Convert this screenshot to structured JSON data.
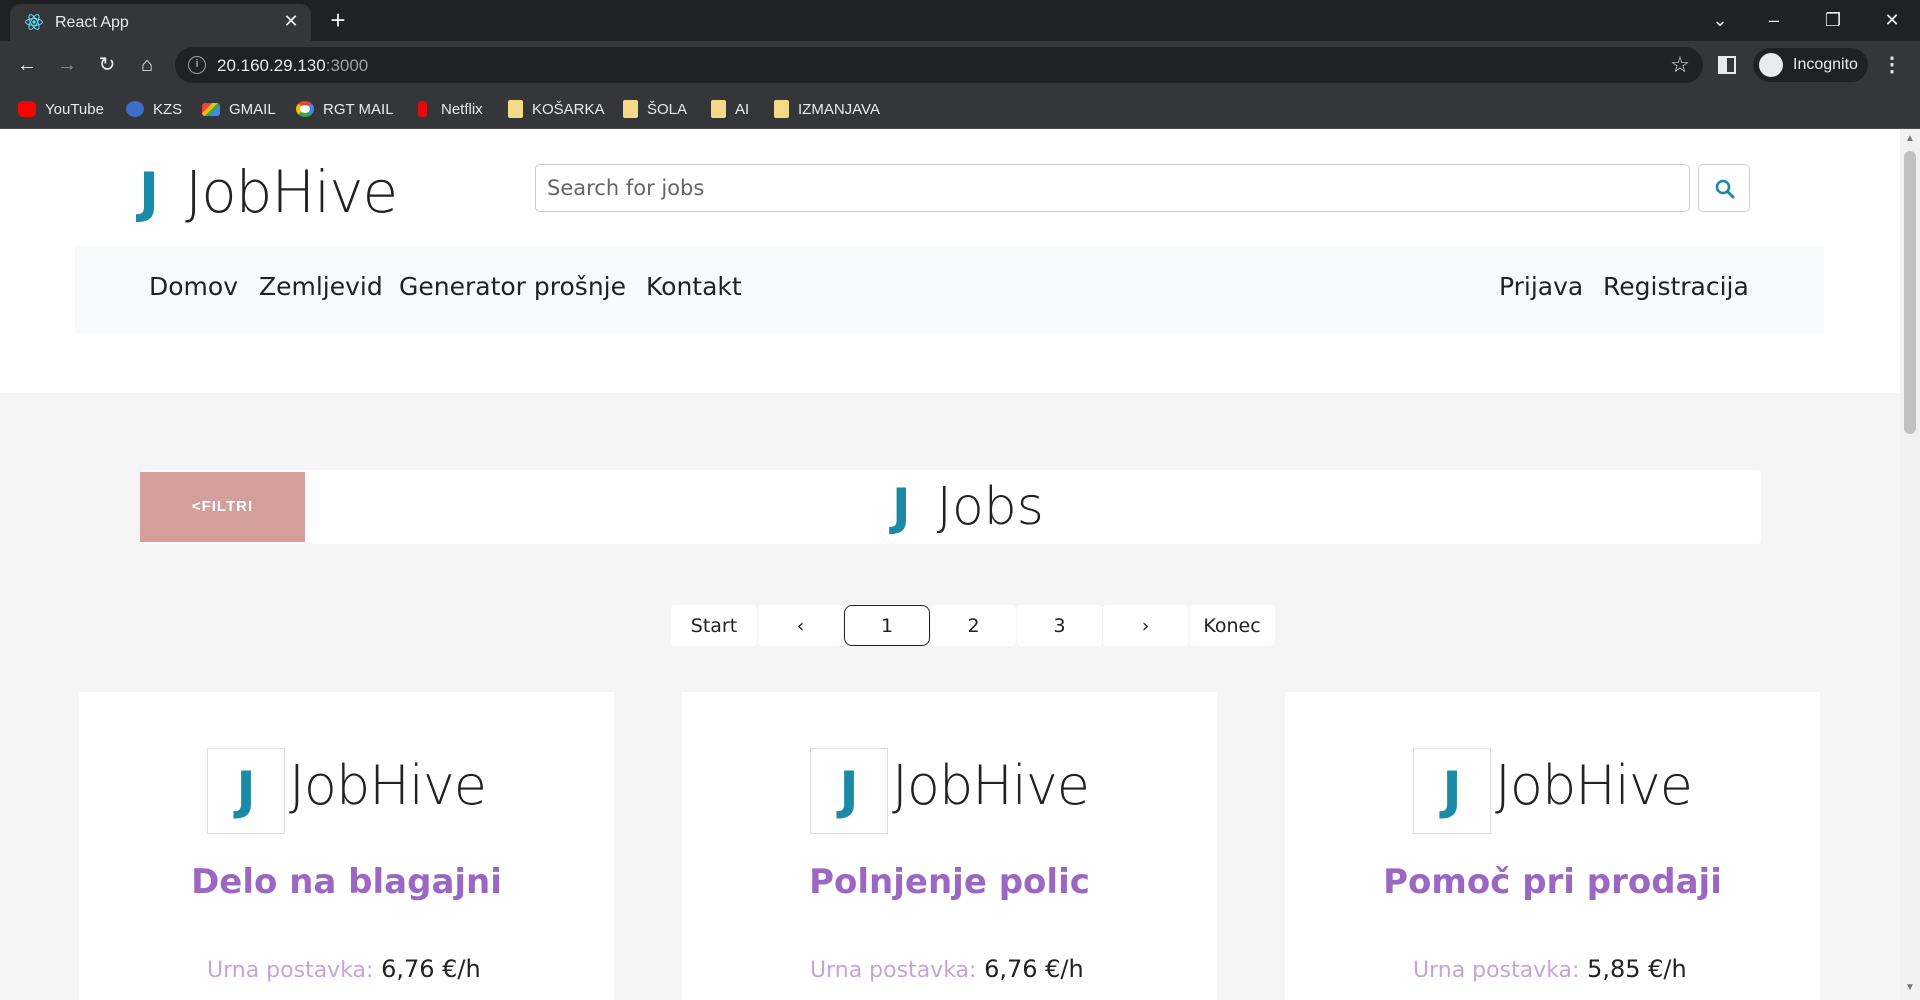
{
  "browser": {
    "tab_title": "React App",
    "url_host": "20.160.29.130",
    "url_port": ":3000",
    "profile_label": "Incognito",
    "bookmarks": [
      "YouTube",
      "KZS",
      "GMAIL",
      "RGT MAIL",
      "Netflix",
      "KOŠARKA",
      "ŠOLA",
      "AI",
      "IZMANJAVA"
    ]
  },
  "header": {
    "logo_letter": "J",
    "logo_text": "JobHive",
    "search_placeholder": "Search for jobs"
  },
  "nav": {
    "left": [
      "Domov",
      "Zemljevid",
      "Generator prošnje",
      "Kontakt"
    ],
    "right": [
      "Prijava",
      "Registracija"
    ]
  },
  "jobs_section": {
    "filter_label": "<FILTRI",
    "title_letter": "J",
    "title": "Jobs",
    "pagination": [
      "Start",
      "‹",
      "1",
      "2",
      "3",
      "›",
      "Konec"
    ],
    "active_page": "1"
  },
  "cards": [
    {
      "logo_letter": "J",
      "logo_text": "JobHive",
      "title": "Delo na blagajni",
      "rate_label": "Urna postavka:",
      "rate_value": "6,76 €/h"
    },
    {
      "logo_letter": "J",
      "logo_text": "JobHive",
      "title": "Polnjenje polic",
      "rate_label": "Urna postavka:",
      "rate_value": "6,76 €/h"
    },
    {
      "logo_letter": "J",
      "logo_text": "JobHive",
      "title": "Pomoč pri prodaji",
      "rate_label": "Urna postavka:",
      "rate_value": "5,85 €/h"
    }
  ],
  "colors": {
    "brand_teal": "#1b8aa6",
    "title_purple": "#9b67c2",
    "filter_button": "#d49e9b"
  }
}
